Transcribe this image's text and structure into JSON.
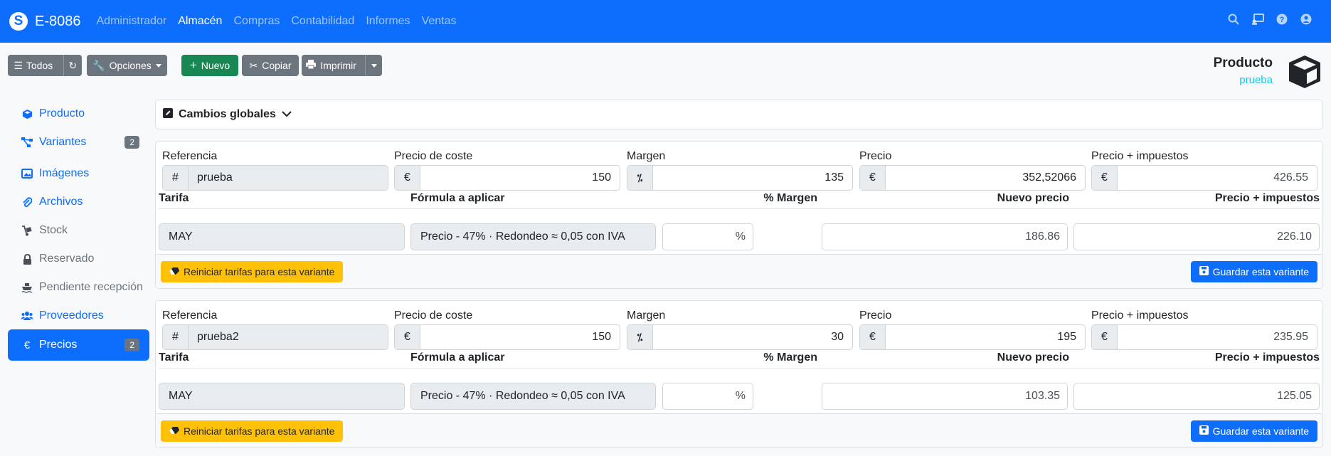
{
  "navbar": {
    "brand": "E-8086",
    "links": [
      "Administrador",
      "Almacén",
      "Compras",
      "Contabilidad",
      "Informes",
      "Ventas"
    ],
    "active_link": "Almacén",
    "icons": [
      "search-icon",
      "presentation-icon",
      "help-icon",
      "user-icon"
    ]
  },
  "toolbar": {
    "all_label": "Todos",
    "options_label": "Opciones",
    "new_label": "Nuevo",
    "copy_label": "Copiar",
    "print_label": "Imprimir"
  },
  "page_title": {
    "main": "Producto",
    "sub": "prueba"
  },
  "sidebar": {
    "items": [
      {
        "label": "Producto",
        "icon": "cube-icon",
        "state": "link"
      },
      {
        "label": "Variantes",
        "icon": "sitemap-icon",
        "state": "link",
        "badge": "2"
      },
      {
        "label": "Imágenes",
        "icon": "images-icon",
        "state": "link"
      },
      {
        "label": "Archivos",
        "icon": "paperclip-icon",
        "state": "link"
      },
      {
        "label": "Stock",
        "icon": "dolly-icon",
        "state": "muted"
      },
      {
        "label": "Reservado",
        "icon": "lock-icon",
        "state": "muted"
      },
      {
        "label": "Pendiente recepción",
        "icon": "ship-icon",
        "state": "muted"
      },
      {
        "label": "Proveedores",
        "icon": "users-icon",
        "state": "link"
      },
      {
        "label": "Precios",
        "icon": "euro-icon",
        "state": "active",
        "badge": "2"
      }
    ]
  },
  "global_changes": {
    "label": "Cambios globales"
  },
  "labels": {
    "reference": "Referencia",
    "cost_price": "Precio de coste",
    "margin": "Margen",
    "price": "Precio",
    "price_tax": "Precio + impuestos",
    "rate": "Tarifa",
    "formula": "Fórmula a aplicar",
    "pct_margin": "% Margen",
    "new_price": "Nuevo precio",
    "new_price_tax": "Precio + impuestos",
    "reset_button": "Reiniciar tarifas para esta variante",
    "save_button": "Guardar esta variante",
    "hash": "#",
    "euro": "€",
    "pct": "%"
  },
  "variants": [
    {
      "reference": "prueba",
      "cost": "150",
      "margin": "135",
      "price": "352,52066",
      "price_tax": "426.55",
      "rate": "MAY",
      "formula": "Precio - 47% · Redondeo ≈ 0,05 con IVA",
      "pct_margin": "",
      "new_price": "186.86",
      "new_price_tax": "226.10"
    },
    {
      "reference": "prueba2",
      "cost": "150",
      "margin": "30",
      "price": "195",
      "price_tax": "235.95",
      "rate": "MAY",
      "formula": "Precio - 47% · Redondeo ≈ 0,05 con IVA",
      "pct_margin": "",
      "new_price": "103.35",
      "new_price_tax": "125.05"
    }
  ]
}
